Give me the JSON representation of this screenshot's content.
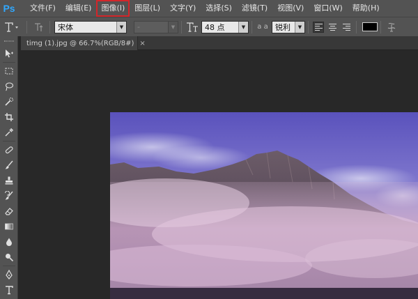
{
  "app": {
    "logo": "Ps"
  },
  "menu": {
    "items": [
      {
        "label": "文件(F)"
      },
      {
        "label": "编辑(E)"
      },
      {
        "label": "图像(I)"
      },
      {
        "label": "图层(L)"
      },
      {
        "label": "文字(Y)"
      },
      {
        "label": "选择(S)"
      },
      {
        "label": "滤镜(T)"
      },
      {
        "label": "视图(V)"
      },
      {
        "label": "窗口(W)"
      },
      {
        "label": "帮助(H)"
      }
    ],
    "highlighted_item": "图像(I)",
    "highlight_color": "#d4262a"
  },
  "options": {
    "tool_icon": "type-tool-icon",
    "orientation_icon": "text-orientation-icon",
    "font_family": "宋体",
    "font_style": "-",
    "size_icon": "font-size-icon",
    "font_size": "48 点",
    "aa_label": "a a",
    "antialias": "锐利",
    "text_color": "#000000"
  },
  "document": {
    "tab_title": "timg (1).jpg @ 66.7%(RGB/8#)",
    "close_glyph": "×"
  },
  "colors": {
    "menubar_bg": "#535353",
    "workspace_bg": "#282828",
    "ps_blue": "#31a8ff"
  }
}
